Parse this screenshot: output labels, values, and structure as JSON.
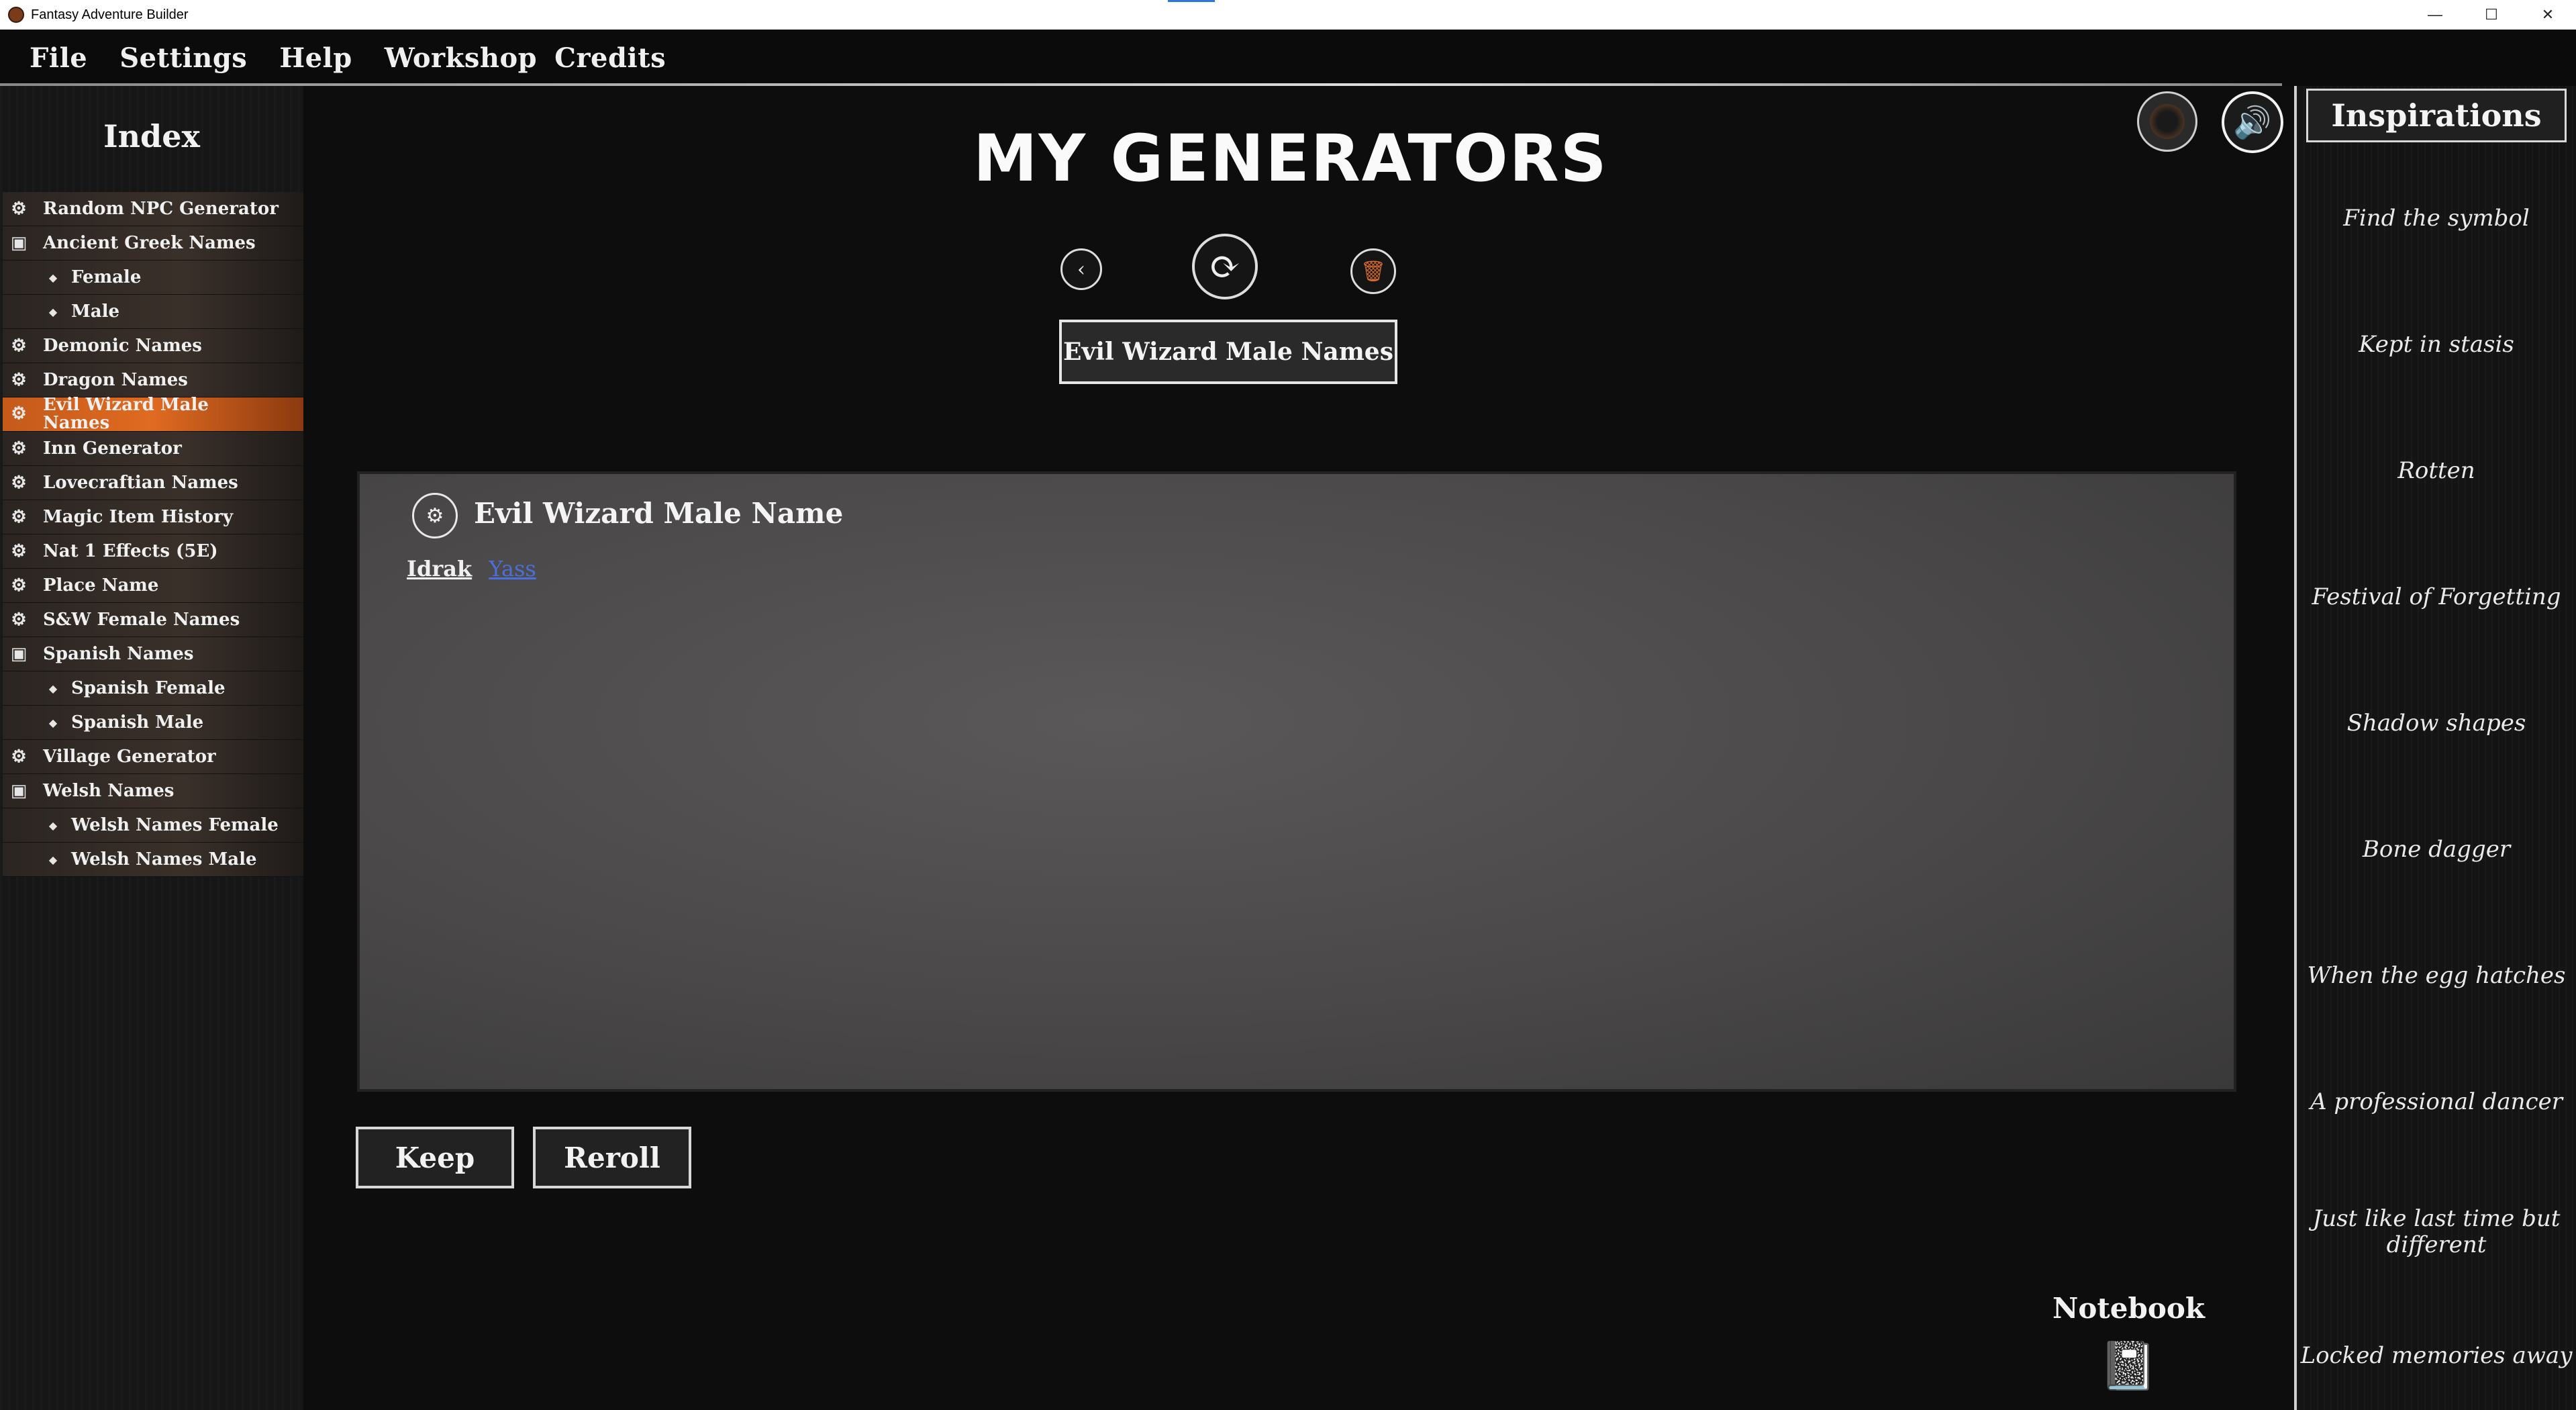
{
  "window": {
    "title": "Fantasy Adventure Builder",
    "controls": {
      "minimize": "—",
      "maximize": "☐",
      "close": "✕"
    }
  },
  "menu": [
    "File",
    "Settings",
    "Help",
    "Workshop",
    "Credits"
  ],
  "sidebar": {
    "title": "Index",
    "items": [
      {
        "label": "Random NPC Generator",
        "icon": "gear-icon",
        "child": false,
        "selected": false
      },
      {
        "label": "Ancient Greek Names",
        "icon": "folder-icon",
        "child": false,
        "selected": false
      },
      {
        "label": "Female",
        "icon": "leaf-icon",
        "child": true,
        "selected": false
      },
      {
        "label": "Male",
        "icon": "leaf-icon",
        "child": true,
        "selected": false
      },
      {
        "label": "Demonic Names",
        "icon": "gear-icon",
        "child": false,
        "selected": false
      },
      {
        "label": "Dragon Names",
        "icon": "gear-icon",
        "child": false,
        "selected": false
      },
      {
        "label": "Evil Wizard Male Names",
        "icon": "gear-icon",
        "child": false,
        "selected": true
      },
      {
        "label": "Inn Generator",
        "icon": "gear-icon",
        "child": false,
        "selected": false
      },
      {
        "label": "Lovecraftian Names",
        "icon": "gear-icon",
        "child": false,
        "selected": false
      },
      {
        "label": "Magic Item History",
        "icon": "gear-icon",
        "child": false,
        "selected": false
      },
      {
        "label": "Nat 1 Effects (5E)",
        "icon": "gear-icon",
        "child": false,
        "selected": false
      },
      {
        "label": "Place Name",
        "icon": "gear-icon",
        "child": false,
        "selected": false
      },
      {
        "label": "S&W Female Names",
        "icon": "gear-icon",
        "child": false,
        "selected": false
      },
      {
        "label": "Spanish Names",
        "icon": "folder-icon",
        "child": false,
        "selected": false
      },
      {
        "label": "Spanish Female",
        "icon": "leaf-icon",
        "child": true,
        "selected": false
      },
      {
        "label": "Spanish Male",
        "icon": "leaf-icon",
        "child": true,
        "selected": false
      },
      {
        "label": "Village Generator",
        "icon": "gear-icon",
        "child": false,
        "selected": false
      },
      {
        "label": "Welsh Names",
        "icon": "folder-icon",
        "child": false,
        "selected": false
      },
      {
        "label": "Welsh Names Female",
        "icon": "leaf-icon",
        "child": true,
        "selected": false
      },
      {
        "label": "Welsh Names Male",
        "icon": "leaf-icon",
        "child": true,
        "selected": false
      }
    ]
  },
  "main": {
    "title": "MY GENERATORS",
    "generator_name": "Evil Wizard Male Names",
    "output": {
      "title": "Evil Wizard Male Name",
      "result_first": "Idrak",
      "result_second": "Yass"
    },
    "keep_label": "Keep",
    "reroll_label": "Reroll",
    "notebook_label": "Notebook"
  },
  "inspirations": {
    "title": "Inspirations",
    "items": [
      "Find the symbol",
      "Kept in stasis",
      "Rotten",
      "Festival of Forgetting",
      "Shadow shapes",
      "Bone dagger",
      "When the egg hatches",
      "A professional dancer",
      "Just like last time but different",
      "Locked memories away"
    ]
  },
  "colors": {
    "selected": "#e06a20",
    "link": "#4a6fd8",
    "background": "#0d0d0d"
  }
}
